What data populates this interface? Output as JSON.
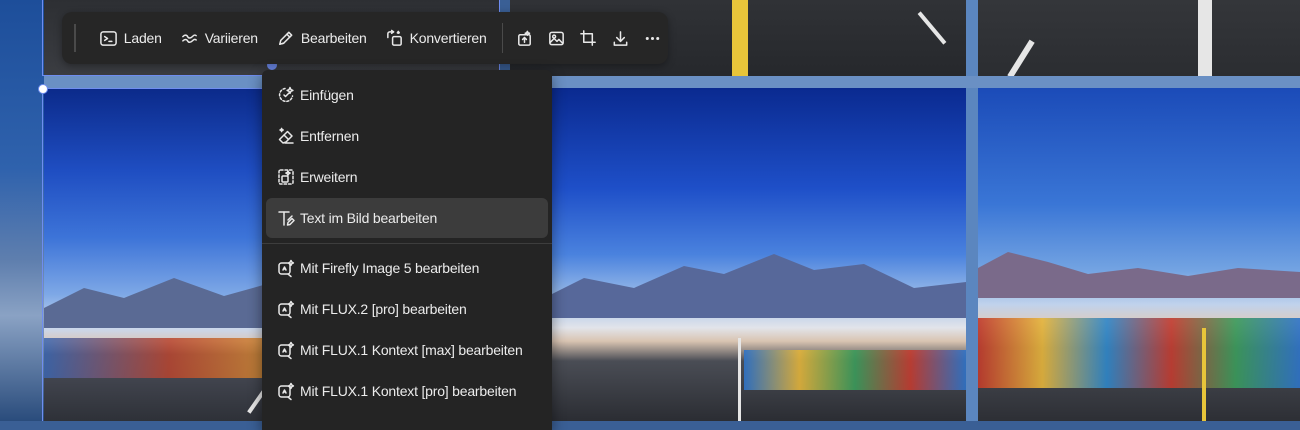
{
  "toolbar": {
    "buttons": [
      {
        "label": "Laden",
        "icon": "terminal-icon"
      },
      {
        "label": "Variieren",
        "icon": "waves-icon"
      },
      {
        "label": "Bearbeiten",
        "icon": "pencil-icon"
      },
      {
        "label": "Konvertieren",
        "icon": "convert-icon"
      }
    ],
    "icon_buttons": [
      "upscale-icon",
      "image-icon",
      "crop-icon",
      "download-icon",
      "more-icon"
    ]
  },
  "menu": {
    "items": [
      {
        "label": "Einfügen",
        "icon": "insert-sparkle-icon"
      },
      {
        "label": "Entfernen",
        "icon": "eraser-icon"
      },
      {
        "label": "Erweitern",
        "icon": "expand-icon"
      },
      {
        "label": "Text im Bild bearbeiten",
        "icon": "text-edit-icon",
        "active": true
      }
    ],
    "model_items": [
      {
        "label": "Mit Firefly Image 5 bearbeiten",
        "icon": "model-edit-icon"
      },
      {
        "label": "Mit FLUX.2 [pro] bearbeiten",
        "icon": "model-edit-icon"
      },
      {
        "label": "Mit FLUX.1 Kontext [max] bearbeiten",
        "icon": "model-edit-icon"
      },
      {
        "label": "Mit FLUX.1 Kontext [pro] bearbeiten",
        "icon": "model-edit-icon"
      }
    ]
  },
  "colors": {
    "toolbar_bg": "#262626",
    "menu_bg": "#242424",
    "menu_active": "#3c3c3c",
    "selection": "#6f8df0"
  }
}
